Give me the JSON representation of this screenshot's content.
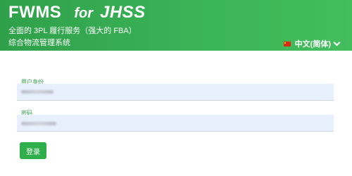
{
  "header": {
    "brand_main": "FWMS",
    "brand_for": "for",
    "brand_sub": "JHSS",
    "tagline": "全面的 3PL 履行服务（强大的 FBA）",
    "tagline2": "综合物流管理系统",
    "language": {
      "flag_icon": "china-flag-icon",
      "label": "中文(简体)",
      "dropdown_icon": "chevron-down-icon"
    },
    "background_color": "#3bb357"
  },
  "form": {
    "username": {
      "label": "用户身份",
      "value": ""
    },
    "password": {
      "label": "密码",
      "value": ""
    },
    "login_button": "登录",
    "accent_color": "#2fae4c",
    "input_background": "#e8f0fe"
  }
}
